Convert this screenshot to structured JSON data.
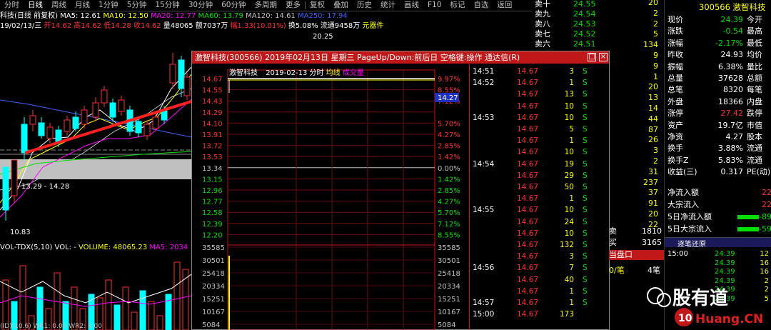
{
  "toolbar": {
    "items": [
      "分时",
      "日线",
      "周线",
      "月线",
      "1分钟",
      "5分钟",
      "15分钟",
      "30分钟",
      "60分钟",
      "多周期",
      "更多",
      "复权",
      "叠加",
      "历史",
      "统计",
      "画线",
      "F10",
      "标记",
      "自选",
      "返回"
    ]
  },
  "kline_info": {
    "title": "科技(日线 前复权)",
    "ma5": "MA5: 12.61",
    "ma10": "MA10: 12.50",
    "ma20": "MA20: 12.77",
    "ma60": "MA60: 13.79",
    "ma120": "MA120: 14.61",
    "ma250": "MA250: 17.94",
    "date": "19/02/13/三",
    "open": "开14.62",
    "high": "高14.62",
    "low": "低14.28",
    "close": "收14.62",
    "volume": "量48065",
    "amount": "额7037万",
    "change": "幅1.33(10.01%)",
    "turnover": "换5.08%",
    "float": "流通9458万",
    "sector": "元器件",
    "peak_label": "20.25",
    "range_label": "13.29 - 14.28",
    "low_label": "10.83"
  },
  "volume_info": {
    "label": "VOL-TDX(5,10)",
    "vol": "VOL: -",
    "volume": "VOLUME: 48065.23",
    "ma5": "MA5: 2034",
    "footer": "(ID)(10.6)  WR1: 0.00  WR2: 0.00"
  },
  "dialog": {
    "title": "激智科技(300566) 2019年02月13日 星期三 PageUp/Down:前后日 空格键:操作 通达信(R)",
    "chart_header_name": "激智科技",
    "chart_header_date": "2019-02-13 分时",
    "chart_header_avg": "均线",
    "chart_header_vol": "成交量",
    "current_price_tag": "14.27",
    "price_axis": [
      "14.67",
      "14.55",
      "14.43",
      "14.29",
      "14.10",
      "13.91",
      "13.72",
      "13.53",
      "13.34",
      "13.15",
      "12.96",
      "12.77",
      "12.58",
      "12.39",
      "12.20"
    ],
    "pct_axis": [
      "9.97%",
      "8.55%",
      "7.12%",
      "",
      "5.70%",
      "4.27%",
      "2.85%",
      "1.42%",
      "0.00%",
      "1.42%",
      "2.85%",
      "4.27%",
      "5.70%",
      "7.12%",
      "8.55%"
    ],
    "vol_axis": [
      "35585",
      "30501",
      "25418",
      "20334",
      "15251",
      "10167",
      "5084"
    ]
  },
  "trades": [
    {
      "time": "14:51",
      "price": "14.67",
      "vol": "3",
      "side": "S"
    },
    {
      "time": "14:52",
      "price": "14.67",
      "vol": "1",
      "side": "S"
    },
    {
      "time": "",
      "price": "14.67",
      "vol": "13",
      "side": "S"
    },
    {
      "time": "",
      "price": "14.67",
      "vol": "10",
      "side": "S"
    },
    {
      "time": "14:53",
      "price": "14.67",
      "vol": "10",
      "side": "S"
    },
    {
      "time": "",
      "price": "14.67",
      "vol": "5",
      "side": "S"
    },
    {
      "time": "",
      "price": "14.67",
      "vol": "1",
      "side": "S"
    },
    {
      "time": "",
      "price": "14.67",
      "vol": "10",
      "side": "S"
    },
    {
      "time": "14:54",
      "price": "14.67",
      "vol": "19",
      "side": "S"
    },
    {
      "time": "",
      "price": "14.67",
      "vol": "29",
      "side": "S"
    },
    {
      "time": "",
      "price": "14.67",
      "vol": "50",
      "side": "S"
    },
    {
      "time": "",
      "price": "14.67",
      "vol": "1",
      "side": "S"
    },
    {
      "time": "14:55",
      "price": "14.67",
      "vol": "10",
      "side": "S"
    },
    {
      "time": "",
      "price": "14.67",
      "vol": "24",
      "side": "S"
    },
    {
      "time": "",
      "price": "14.67",
      "vol": "10",
      "side": "S"
    },
    {
      "time": "",
      "price": "14.67",
      "vol": "132",
      "side": "S"
    },
    {
      "time": "",
      "price": "14.67",
      "vol": "3",
      "side": "S"
    },
    {
      "time": "14:56",
      "price": "14.67",
      "vol": "7",
      "side": "S"
    },
    {
      "time": "",
      "price": "14.67",
      "vol": "40",
      "side": "S"
    },
    {
      "time": "",
      "price": "14.67",
      "vol": "1",
      "side": "S"
    },
    {
      "time": "14:57",
      "price": "14.67",
      "vol": "1",
      "side": "S"
    },
    {
      "time": "15:00",
      "price": "14.67",
      "vol": "173",
      "side": ""
    }
  ],
  "sell_book": [
    {
      "label": "卖十",
      "price": "24.55",
      "vol": "20"
    },
    {
      "label": "卖九",
      "price": "24.54",
      "vol": "2"
    },
    {
      "label": "卖八",
      "price": "24.53",
      "vol": "2"
    },
    {
      "label": "卖七",
      "price": "24.52",
      "vol": "5"
    },
    {
      "label": "卖六",
      "price": "24.51",
      "vol": "134"
    }
  ],
  "right_vols": [
    "20",
    "2",
    "2",
    "5",
    "134",
    "9",
    "9",
    "1",
    "20",
    "13",
    "14",
    "44",
    "87",
    "26",
    "3",
    "2",
    "31",
    "237",
    "37",
    "91",
    "20",
    "22"
  ],
  "outer_rows": [
    {
      "label": "卖",
      "val": "1810"
    },
    {
      "label": "买",
      "val": "3165"
    }
  ],
  "bid_bar": "当盘口",
  "bid_line": {
    "label": "0/笔",
    "val": "4笔"
  },
  "quote": {
    "code_name": "300566 激智科技",
    "rows": [
      {
        "l": "现价",
        "v": "24.39",
        "r": "今开"
      },
      {
        "l": "涨跌",
        "v": "-0.54",
        "r": "最高"
      },
      {
        "l": "涨幅",
        "v": "-2.17%",
        "r": "最低"
      },
      {
        "l": "昨收",
        "v": "24.93",
        "r": "均价"
      },
      {
        "l": "振幅",
        "v": "6.38%",
        "r": "量比"
      },
      {
        "l": "总量",
        "v": "37628",
        "r": "总额"
      },
      {
        "l": "总笔",
        "v": "8320",
        "r": "每笔"
      },
      {
        "l": "外盘",
        "v": "18366",
        "r": "内盘"
      },
      {
        "l": "涨停",
        "v": "27.42",
        "r": "跌停"
      },
      {
        "l": "资产",
        "v": "19.7亿",
        "r": "市值"
      },
      {
        "l": "净资",
        "v": "4.27",
        "r": "股本"
      },
      {
        "l": "换手",
        "v": "3.88%",
        "r": "流通"
      },
      {
        "l": "换手Z",
        "v": "5.83%",
        "r": "流通"
      },
      {
        "l": "收益(三)",
        "v": "0.317",
        "r": "PE(动)"
      }
    ],
    "flows": [
      {
        "l": "净流入额",
        "v": "22"
      },
      {
        "l": "大宗流入",
        "v": "22"
      },
      {
        "l": "5日净流入额",
        "v": "-89"
      },
      {
        "l": "5日大宗流入",
        "v": "-59"
      }
    ],
    "tick_title": "逐笔还原",
    "ticks": [
      {
        "t": "15:00",
        "p": "24.39",
        "v": "12"
      },
      {
        "t": "",
        "p": "24.39",
        "v": "16"
      },
      {
        "t": "",
        "p": "24.39",
        "v": "16"
      },
      {
        "t": "",
        "p": "24.39",
        "v": "2"
      },
      {
        "t": "",
        "p": "24.39",
        "v": "2"
      },
      {
        "t": "",
        "p": "24.39",
        "v": "5"
      }
    ]
  },
  "watermark": {
    "text": "股有道",
    "site": "Huang.CN"
  }
}
